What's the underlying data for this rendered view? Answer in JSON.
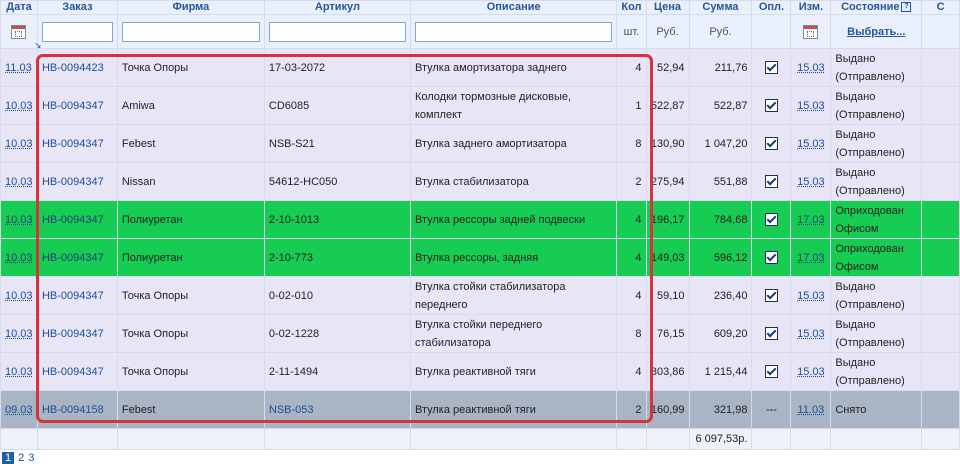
{
  "headers": {
    "date": "Дата",
    "order": "Заказ",
    "firm": "Фирма",
    "article": "Артикул",
    "description": "Описание",
    "qty": "Кол",
    "price": "Цена",
    "sum": "Сумма",
    "paid": "Опл.",
    "changed": "Изм.",
    "state": "Состояние",
    "extra": "С"
  },
  "units": {
    "qty": "шт.",
    "price": "Руб.",
    "sum": "Руб."
  },
  "filters": {
    "order": "",
    "firm": "",
    "article": "",
    "description": ""
  },
  "state_select": "Выбрать...",
  "rows": [
    {
      "status": "normal",
      "date": "11.03",
      "order": "HB-0094423",
      "firm": "Точка Опоры",
      "article": "17-03-2072",
      "article_link": false,
      "description": "Втулка амортизатора заднего",
      "qty": "4",
      "price": "52,94",
      "sum": "211,76",
      "paid": true,
      "changed": "15.03",
      "state": "Выдано (Отправлено)"
    },
    {
      "status": "normal",
      "date": "10.03",
      "order": "HB-0094347",
      "firm": "Amiwa",
      "article": "CD6085",
      "article_link": false,
      "description": "Колодки тормозные дисковые, комплект",
      "qty": "1",
      "price": "522,87",
      "sum": "522,87",
      "paid": true,
      "changed": "15.03",
      "state": "Выдано (Отправлено)"
    },
    {
      "status": "normal",
      "date": "10.03",
      "order": "HB-0094347",
      "firm": "Febest",
      "article": "NSB-S21",
      "article_link": false,
      "description": "Втулка заднего амортизатора",
      "qty": "8",
      "price": "130,90",
      "sum": "1 047,20",
      "paid": true,
      "changed": "15.03",
      "state": "Выдано (Отправлено)"
    },
    {
      "status": "normal",
      "date": "10.03",
      "order": "HB-0094347",
      "firm": "Nissan",
      "article": "54612-HC050",
      "article_link": false,
      "description": "Втулка стабилизатора",
      "qty": "2",
      "price": "275,94",
      "sum": "551,88",
      "paid": true,
      "changed": "15.03",
      "state": "Выдано (Отправлено)"
    },
    {
      "status": "green",
      "date": "10.03",
      "order": "HB-0094347",
      "firm": "Полиуретан",
      "article": "2-10-1013",
      "article_link": false,
      "description": "Втулка рессоры задней подвески",
      "qty": "4",
      "price": "196,17",
      "sum": "784,68",
      "paid": true,
      "changed": "17.03",
      "state": "Оприходован Офисом"
    },
    {
      "status": "green",
      "date": "10.03",
      "order": "HB-0094347",
      "firm": "Полиуретан",
      "article": "2-10-773",
      "article_link": false,
      "description": "Втулка рессоры, задняя",
      "qty": "4",
      "price": "149,03",
      "sum": "596,12",
      "paid": true,
      "changed": "17.03",
      "state": "Оприходован Офисом"
    },
    {
      "status": "normal",
      "date": "10.03",
      "order": "HB-0094347",
      "firm": "Точка Опоры",
      "article": "0-02-010",
      "article_link": false,
      "description": "Втулка стойки стабилизатора переднего",
      "qty": "4",
      "price": "59,10",
      "sum": "236,40",
      "paid": true,
      "changed": "15.03",
      "state": "Выдано (Отправлено)"
    },
    {
      "status": "normal",
      "date": "10.03",
      "order": "HB-0094347",
      "firm": "Точка Опоры",
      "article": "0-02-1228",
      "article_link": false,
      "description": "Втулка стойки переднего стабилизатора",
      "qty": "8",
      "price": "76,15",
      "sum": "609,20",
      "paid": true,
      "changed": "15.03",
      "state": "Выдано (Отправлено)"
    },
    {
      "status": "normal",
      "date": "10.03",
      "order": "HB-0094347",
      "firm": "Точка Опоры",
      "article": "2-11-1494",
      "article_link": false,
      "description": "Втулка реактивной тяги",
      "qty": "4",
      "price": "303,86",
      "sum": "1 215,44",
      "paid": true,
      "changed": "15.03",
      "state": "Выдано (Отправлено)"
    },
    {
      "status": "cancel",
      "date": "09.03",
      "order": "HB-0094158",
      "firm": "Febest",
      "article": "NSB-053",
      "article_link": true,
      "description": "Втулка реактивной тяги",
      "qty": "2",
      "price": "160,99",
      "sum": "321,98",
      "paid": false,
      "paid_text": "---",
      "changed": "11.03",
      "state": "Снято"
    }
  ],
  "total": "6 097,53р.",
  "pager": {
    "current": "1",
    "pages": [
      "2",
      "3"
    ]
  }
}
